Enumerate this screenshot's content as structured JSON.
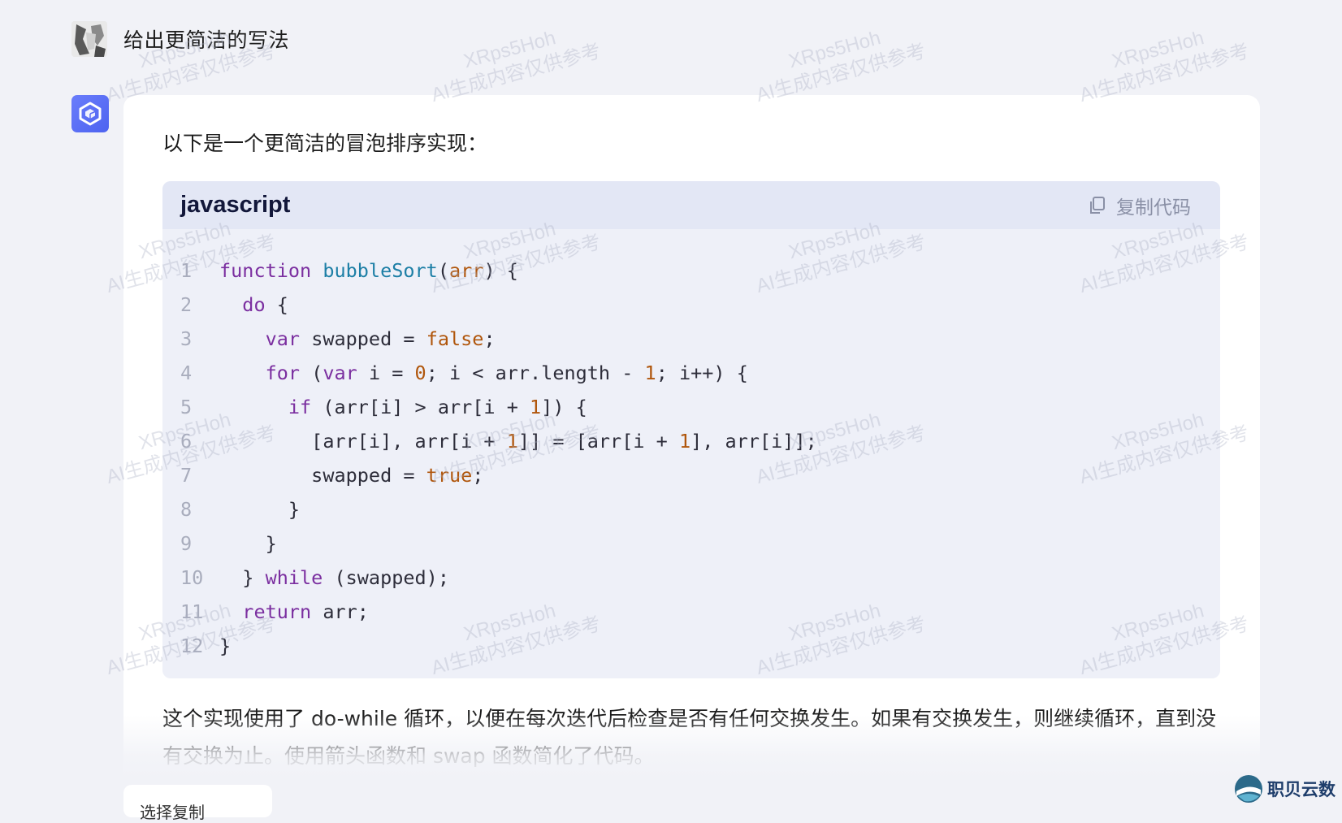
{
  "user": {
    "message": "给出更简洁的写法"
  },
  "answer": {
    "intro": "以下是一个更简洁的冒泡排序实现：",
    "code": {
      "language": "javascript",
      "copy_label": "复制代码",
      "lines": [
        "1",
        "2",
        "3",
        "4",
        "5",
        "6",
        "7",
        "8",
        "9",
        "10",
        "11",
        "12"
      ]
    },
    "paragraph": "这个实现使用了 do-while 循环，以便在每次迭代后检查是否有任何交换发生。如果有交换发生，则继续循环，直到没有交换为止。使用箭头函数和 swap 函数简化了代码。"
  },
  "bottom_button": {
    "label": "选择复制"
  },
  "watermark": {
    "line1": "XRps5Hoh",
    "line2": "AI生成内容仅供参考"
  },
  "logo": {
    "text": "职贝云数"
  },
  "colors": {
    "background": "#f1f2f7",
    "accent": "#4d63f0",
    "code_bg": "#eef0f8",
    "code_header_bg": "#e3e7f5",
    "keyword": "#7b2fa0",
    "function_name": "#1d7fa6",
    "literal": "#b0560c"
  },
  "icons": {
    "bot_avatar": "cube-logo-icon",
    "copy": "copy-icon"
  }
}
